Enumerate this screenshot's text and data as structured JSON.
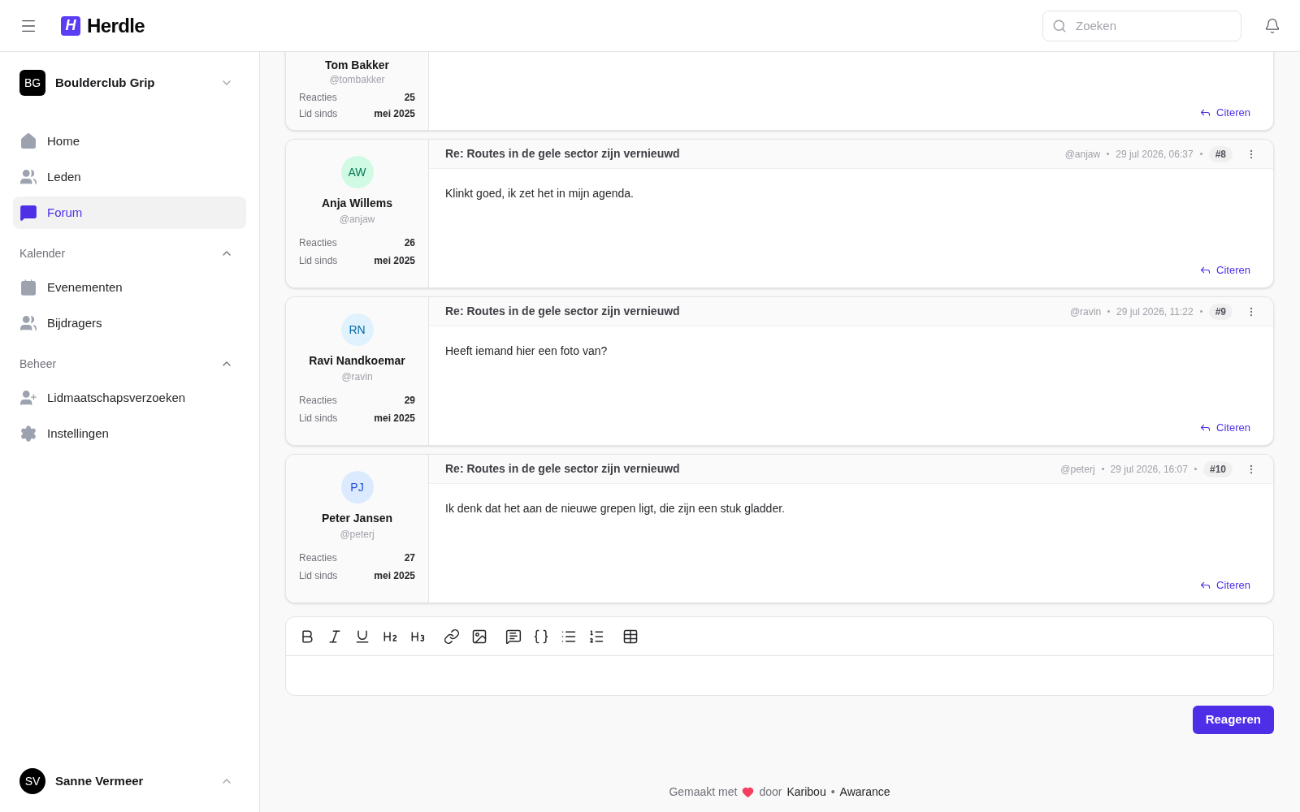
{
  "header": {
    "logo_letter": "H",
    "brand": "Herdle",
    "search_placeholder": "Zoeken"
  },
  "sidebar": {
    "org": {
      "initials": "BG",
      "name": "Boulderclub Grip",
      "expanded": false
    },
    "nav": [
      {
        "label": "Home",
        "selected": false
      },
      {
        "label": "Leden",
        "selected": false
      },
      {
        "label": "Forum",
        "selected": true
      }
    ],
    "sections": [
      {
        "title": "Kalender",
        "expanded": true,
        "items": [
          {
            "label": "Evenementen",
            "selected": false
          },
          {
            "label": "Bijdragers",
            "selected": false
          }
        ]
      },
      {
        "title": "Beheer",
        "expanded": true,
        "items": [
          {
            "label": "Lidmaatschapsverzoeken",
            "selected": false
          },
          {
            "label": "Instellingen",
            "selected": false
          }
        ]
      }
    ],
    "user": {
      "initials": "SV",
      "name": "Sanne Vermeer",
      "expanded": true
    }
  },
  "posts": [
    {
      "author": "Tom Bakker",
      "handle": "@tombakker",
      "stats": [
        {
          "label": "Reacties",
          "value": "25"
        },
        {
          "label": "Lid sinds",
          "value": "mei 2025"
        }
      ],
      "quote": "Citeren"
    },
    {
      "initials": "AW",
      "color": "#d1fae5",
      "author": "Anja Willems",
      "handle": "@anjaw",
      "stats": [
        {
          "label": "Reacties",
          "value": "26"
        },
        {
          "label": "Lid sinds",
          "value": "mei 2025"
        }
      ],
      "title": "Re: Routes in de gele sector zijn vernieuwd",
      "meta_handle": "@anjaw",
      "date": "29 jul 2026, 06:37",
      "number": "#8",
      "body": "Klinkt goed, ik zet het in mijn agenda.",
      "quote": "Citeren"
    },
    {
      "initials": "RN",
      "color": "#e0f2fe",
      "author": "Ravi Nandkoemar",
      "handle": "@ravin",
      "stats": [
        {
          "label": "Reacties",
          "value": "29"
        },
        {
          "label": "Lid sinds",
          "value": "mei 2025"
        }
      ],
      "title": "Re: Routes in de gele sector zijn vernieuwd",
      "meta_handle": "@ravin",
      "date": "29 jul 2026, 11:22",
      "number": "#9",
      "body": "Heeft iemand hier een foto van?",
      "quote": "Citeren"
    },
    {
      "initials": "PJ",
      "color": "#dbeafe",
      "author": "Peter Jansen",
      "handle": "@peterj",
      "stats": [
        {
          "label": "Reacties",
          "value": "27"
        },
        {
          "label": "Lid sinds",
          "value": "mei 2025"
        }
      ],
      "title": "Re: Routes in de gele sector zijn vernieuwd",
      "meta_handle": "@peterj",
      "date": "29 jul 2026, 16:07",
      "number": "#10",
      "body": "Ik denk dat het aan de nieuwe grepen ligt, die zijn een stuk gladder.",
      "quote": "Citeren"
    }
  ],
  "reply_button": "Reageren",
  "footer": {
    "made_with": "Gemaakt met",
    "by": "door",
    "links": [
      "Karibou",
      "Awarance"
    ],
    "separator": "•"
  }
}
